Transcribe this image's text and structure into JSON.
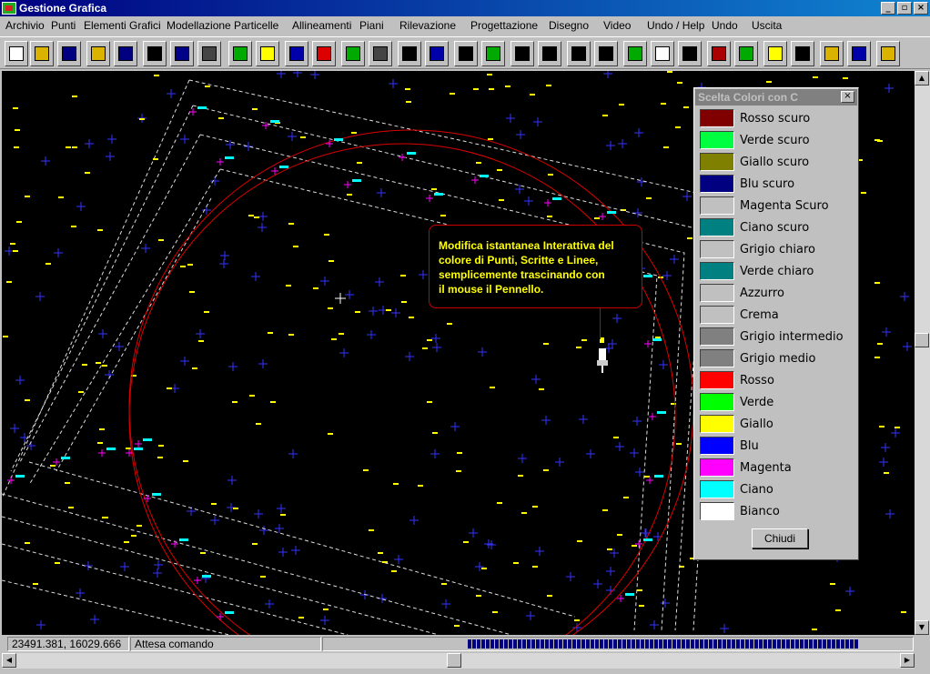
{
  "window": {
    "title": "Gestione Grafica",
    "min": "_",
    "max": "▫",
    "close": "×"
  },
  "menu": [
    "Archivio",
    "Punti",
    "Elementi Grafici",
    "Modellazione",
    "Particelle",
    "Allineamenti",
    "Piani",
    "Rilevazione",
    "Progettazione",
    "Disegno",
    "Video",
    "Undo / Help",
    "Undo",
    "Uscita"
  ],
  "toolbar_icons": [
    "new-file-icon",
    "open-folder-icon",
    "save-disk-icon",
    "open-archive-icon",
    "save-archive-icon",
    "macro-icon",
    "points-icon",
    "curve-icon",
    "map-icon",
    "layers-icon",
    "polyline-icon",
    "polygon-icon",
    "terrain-icon",
    "profile-icon",
    "grid-icon",
    "section-icon",
    "move-icon",
    "globe-icon",
    "zoom-icon",
    "level-icon",
    "pan-hand-icon",
    "zoom-window-icon",
    "back-arrow-icon",
    "blank-icon",
    "list-icon",
    "books-icon",
    "color-grid-icon",
    "eraser-icon",
    "undo-icon",
    "settings-icon",
    "save-settings-icon",
    "exit-door-icon"
  ],
  "status": {
    "coords": "23491.381,   16029.666",
    "message": "Attesa comando"
  },
  "tooltip": {
    "lines": [
      "Modifica istantanea Interattiva del",
      "colore di Punti, Scritte e Linee,",
      "semplicemente trascinando con",
      "il mouse il Pennello."
    ]
  },
  "palette": {
    "title": "Scelta Colori con C",
    "close": "×",
    "button": "Chiudi",
    "colors": [
      {
        "label": "Rosso scuro",
        "color": "#800000"
      },
      {
        "label": "Verde scuro",
        "color": "#00ff40"
      },
      {
        "label": "Giallo scuro",
        "color": "#808000"
      },
      {
        "label": "Blu scuro",
        "color": "#000080"
      },
      {
        "label": "Magenta Scuro",
        "color": "#c0c0c0"
      },
      {
        "label": "Ciano scuro",
        "color": "#008080"
      },
      {
        "label": "Grigio chiaro",
        "color": "#c0c0c0"
      },
      {
        "label": "Verde chiaro",
        "color": "#008080"
      },
      {
        "label": "Azzurro",
        "color": "#c0c0c0"
      },
      {
        "label": "Crema",
        "color": "#c0c0c0"
      },
      {
        "label": "Grigio intermedio",
        "color": "#808080"
      },
      {
        "label": "Grigio medio",
        "color": "#808080"
      },
      {
        "label": "Rosso",
        "color": "#ff0000"
      },
      {
        "label": "Verde",
        "color": "#00ff00"
      },
      {
        "label": "Giallo",
        "color": "#ffff00"
      },
      {
        "label": "Blu",
        "color": "#0000ff"
      },
      {
        "label": "Magenta",
        "color": "#ff00ff"
      },
      {
        "label": "Ciano",
        "color": "#00ffff"
      },
      {
        "label": "Bianco",
        "color": "#ffffff"
      }
    ]
  }
}
